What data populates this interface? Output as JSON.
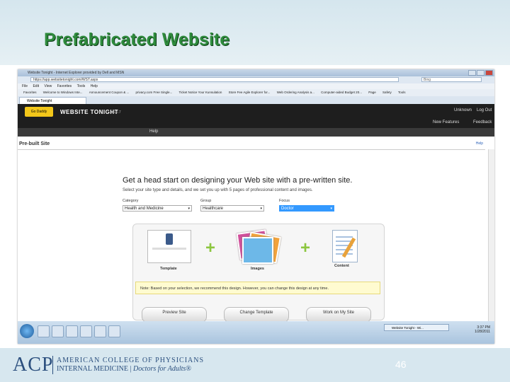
{
  "slide": {
    "title": "Prefabricated Website",
    "number": "46",
    "footer": {
      "logo": "ACP",
      "line1": "AMERICAN COLLEGE OF PHYSICIANS",
      "line2_left": "INTERNAL MEDICINE |",
      "line2_right": "Doctors for Adults®"
    }
  },
  "browser": {
    "title": "Website Tonight - Internet Explorer provided by Dell and MSN",
    "address": "https://app.websitetonight.com/WST.aspx",
    "search_placeholder": "Bing",
    "menu": [
      "File",
      "Edit",
      "View",
      "Favorites",
      "Tools",
      "Help"
    ],
    "favorites": [
      "Favorites",
      "Welcome to Windows Inte...",
      "Announcement Coupon & ...",
      "privacy.com Free Single...",
      "Ticket Notice Your Kunsulation",
      "Store Fee Agile Explorer for...",
      "Web Ordering Analysis a...",
      "Computer-aided Budget 20..."
    ],
    "tab": "Website Tonight",
    "tools": [
      "Page",
      "Safety",
      "Tools"
    ]
  },
  "app": {
    "logo": "Go Daddy",
    "brand": "WEBSITE TONIGHT",
    "version": "v5.0.7",
    "user": "Unknown",
    "logout": "Log Out",
    "new_features": "New Features",
    "feedback": "Feedback",
    "help_menu": "Help"
  },
  "page": {
    "title": "Pre-built Site",
    "help": "Help",
    "headline": "Get a head start on designing your Web site with a pre-written site.",
    "subtext": "Select your site type and details, and we set you up with 5 pages of professional content and images.",
    "fields": [
      {
        "label": "Category",
        "value": "Health and Medicine"
      },
      {
        "label": "Group",
        "value": "Healthcare"
      },
      {
        "label": "Focus",
        "value": "Doctor"
      }
    ],
    "components": [
      "Template",
      "Images",
      "Content"
    ],
    "note": "Note: Based on your selection, we recommend this design. However, you can change this design at any time.",
    "buttons": [
      "Preview Site",
      "Change Template",
      "Work on My Site"
    ]
  },
  "taskbar": {
    "active_item": "Website Tonight - Wi...",
    "tray_time": "3:37 PM",
    "tray_date": "1/28/2011"
  }
}
